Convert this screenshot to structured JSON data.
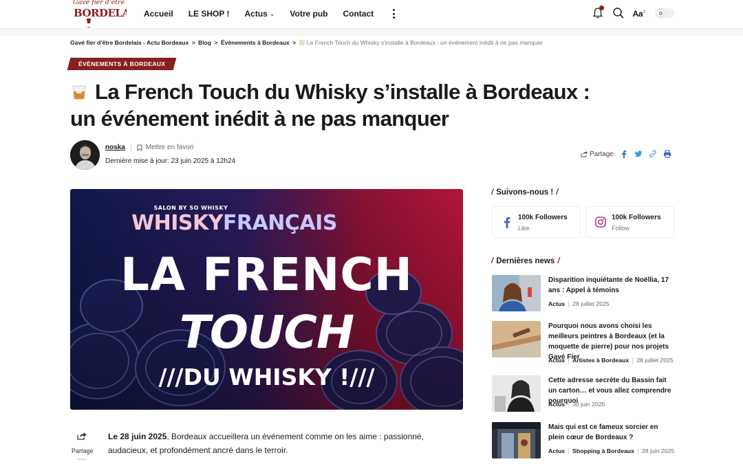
{
  "header": {
    "logo_line1": "Gavé fier d'être",
    "logo_line2": "BORDELAIS",
    "nav": [
      {
        "label": "Accueil"
      },
      {
        "label": "LE SHOP !"
      },
      {
        "label": "Actus"
      },
      {
        "label": "Votre pub"
      },
      {
        "label": "Contact"
      }
    ],
    "font_size_label": "Aa",
    "colors": {
      "brand": "#8a1f1f"
    }
  },
  "breadcrumb": {
    "items": [
      "Gavé fier d'être Bordelais - Actu Bordeaux",
      "Blog",
      "Évènements à Bordeaux"
    ],
    "separator": ">",
    "current": "La French Touch du Whisky s'installe à Bordeaux : un événement inédit à ne pas manquer"
  },
  "article": {
    "category": "ÉVÈNEMENTS À BORDEAUX",
    "title": "La French Touch du Whisky s’installe à Bordeaux : un événement inédit à ne pas manquer",
    "author": "noska",
    "bookmark_label": "Mettre en favori",
    "updated": "Dernière mise à jour: 23 juin 2025 à 12h24",
    "share_label": "Partage",
    "hero": {
      "small": "SALON BY SO WHISKY",
      "brand_part1": "WHISKY",
      "brand_part2": "FRANÇAIS",
      "line1": "LA FRENCH",
      "line2": "TOUCH",
      "line3": "///DU WHISKY !///"
    },
    "intro_bold": "Le 28 juin 2025",
    "intro_rest": ", Bordeaux accueillera un événement comme on les aime : passionné, audacieux, et profondément ancré dans le terroir."
  },
  "sidebar": {
    "follow_heading": "Suivons-nous !",
    "follow": [
      {
        "network": "facebook-icon",
        "count": "100k Followers",
        "action": "Like"
      },
      {
        "network": "instagram-icon",
        "count": "100k Followers",
        "action": "Follow"
      }
    ],
    "news_heading": "Dernières news",
    "news": [
      {
        "title": "Disparition inquiétante de Noëllia, 17 ans : Appel à témoins",
        "cats": [
          "Actus"
        ],
        "date": "28 juillet 2025"
      },
      {
        "title": "Pourquoi nous avons choisi les meilleurs peintres à Bordeaux (et la moquette de pierre) pour nos projets Gavé Fier",
        "cats": [
          "Actus",
          "Artistes à Bordeaux"
        ],
        "date": "28 juillet 2025"
      },
      {
        "title": "Cette adresse secrète du Bassin fait un carton… et vous allez comprendre pourquoi",
        "cats": [
          "Actus"
        ],
        "date": "30 juin 2025"
      },
      {
        "title": "Mais qui est ce fameux sorcier en plein cœur de Bordeaux ?",
        "cats": [
          "Actus",
          "Shopping à Bordeaux"
        ],
        "date": "28 juin 2025"
      }
    ]
  }
}
